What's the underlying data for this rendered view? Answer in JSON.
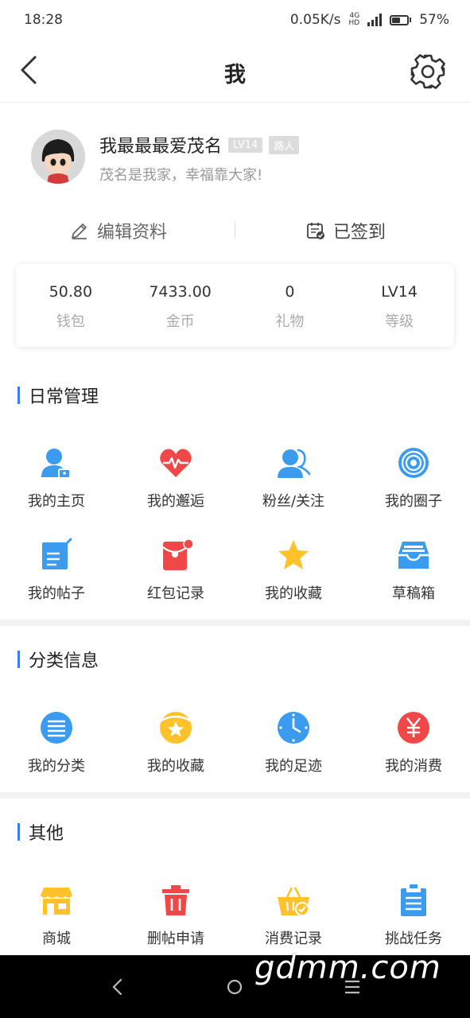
{
  "status_bar": {
    "time": "18:28",
    "net_speed": "0.05K/s",
    "network_type": "4G",
    "hd": "HD",
    "battery": "57%"
  },
  "nav": {
    "title": "我"
  },
  "profile": {
    "name": "我最最最爱茂名",
    "level_badge": "LV14",
    "role_badge": "路人",
    "motto": "茂名是我家，幸福靠大家!"
  },
  "actions": {
    "edit": "编辑资料",
    "signin": "已签到"
  },
  "stats": [
    {
      "value": "50.80",
      "label": "钱包"
    },
    {
      "value": "7433.00",
      "label": "金币"
    },
    {
      "value": "0",
      "label": "礼物"
    },
    {
      "value": "LV14",
      "label": "等级"
    }
  ],
  "sections": {
    "daily": {
      "title": "日常管理",
      "items": [
        {
          "label": "我的主页",
          "icon": "user-home-icon"
        },
        {
          "label": "我的邂逅",
          "icon": "heartbeat-icon"
        },
        {
          "label": "粉丝/关注",
          "icon": "followers-icon"
        },
        {
          "label": "我的圈子",
          "icon": "circle-target-icon"
        },
        {
          "label": "我的帖子",
          "icon": "edit-post-icon"
        },
        {
          "label": "红包记录",
          "icon": "red-packet-icon"
        },
        {
          "label": "我的收藏",
          "icon": "star-icon"
        },
        {
          "label": "草稿箱",
          "icon": "inbox-tray-icon"
        }
      ]
    },
    "category": {
      "title": "分类信息",
      "items": [
        {
          "label": "我的分类",
          "icon": "list-circle-icon"
        },
        {
          "label": "我的收藏",
          "icon": "star-badge-icon"
        },
        {
          "label": "我的足迹",
          "icon": "clock-icon"
        },
        {
          "label": "我的消费",
          "icon": "yuan-icon"
        }
      ]
    },
    "other": {
      "title": "其他",
      "items": [
        {
          "label": "商城",
          "icon": "shop-icon"
        },
        {
          "label": "删帖申请",
          "icon": "trash-icon"
        },
        {
          "label": "消费记录",
          "icon": "basket-icon"
        },
        {
          "label": "挑战任务",
          "icon": "clipboard-icon"
        }
      ]
    }
  },
  "watermark": "gdmm.com",
  "colors": {
    "accent": "#3b7cff",
    "blue": "#3a9bef",
    "red": "#f04848",
    "yellow": "#ffc22b"
  }
}
